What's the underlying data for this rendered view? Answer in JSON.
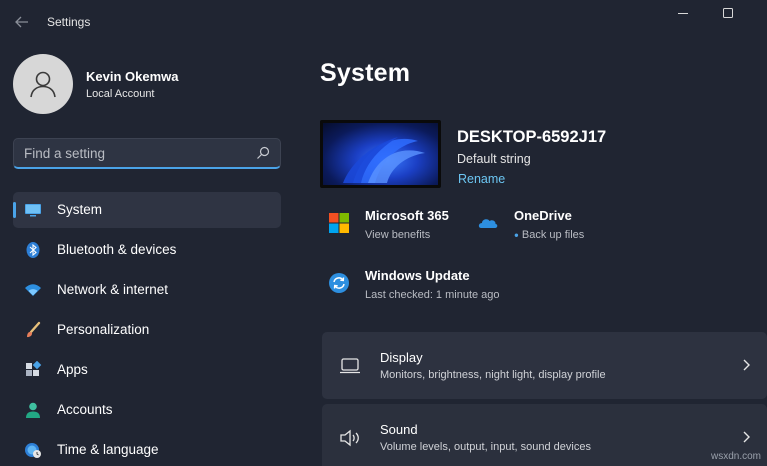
{
  "window": {
    "title": "Settings",
    "icons": [
      "back-arrow-icon",
      "minimize-icon",
      "maximize-icon"
    ]
  },
  "user": {
    "name": "Kevin Okemwa",
    "account": "Local Account"
  },
  "search": {
    "placeholder": "Find a setting"
  },
  "nav": {
    "items": [
      {
        "label": "System",
        "icon": "monitor-icon",
        "active": true
      },
      {
        "label": "Bluetooth & devices",
        "icon": "bluetooth-icon"
      },
      {
        "label": "Network & internet",
        "icon": "wifi-icon"
      },
      {
        "label": "Personalization",
        "icon": "brush-icon"
      },
      {
        "label": "Apps",
        "icon": "apps-grid-icon"
      },
      {
        "label": "Accounts",
        "icon": "person-icon"
      },
      {
        "label": "Time & language",
        "icon": "globe-clock-icon"
      }
    ]
  },
  "main": {
    "title": "System",
    "device": {
      "name": "DESKTOP-6592J17",
      "model": "Default string",
      "rename": "Rename"
    },
    "tiles": [
      {
        "title": "Microsoft 365",
        "subtitle": "View benefits",
        "icon": "microsoft-logo-icon"
      },
      {
        "title": "OneDrive",
        "subtitle": "Back up files",
        "icon": "cloud-icon"
      },
      {
        "title": "Windows Update",
        "subtitle": "Last checked: 1 minute ago",
        "icon": "update-icon"
      }
    ],
    "cards": [
      {
        "title": "Display",
        "subtitle": "Monitors, brightness, night light, display profile",
        "icon": "laptop-icon"
      },
      {
        "title": "Sound",
        "subtitle": "Volume levels, output, input, sound devices",
        "icon": "speaker-icon"
      }
    ]
  },
  "watermark": "wsxdn.com",
  "colors": {
    "background": "#202532",
    "accent": "#4aa3e8",
    "link": "#6cc6f2"
  }
}
